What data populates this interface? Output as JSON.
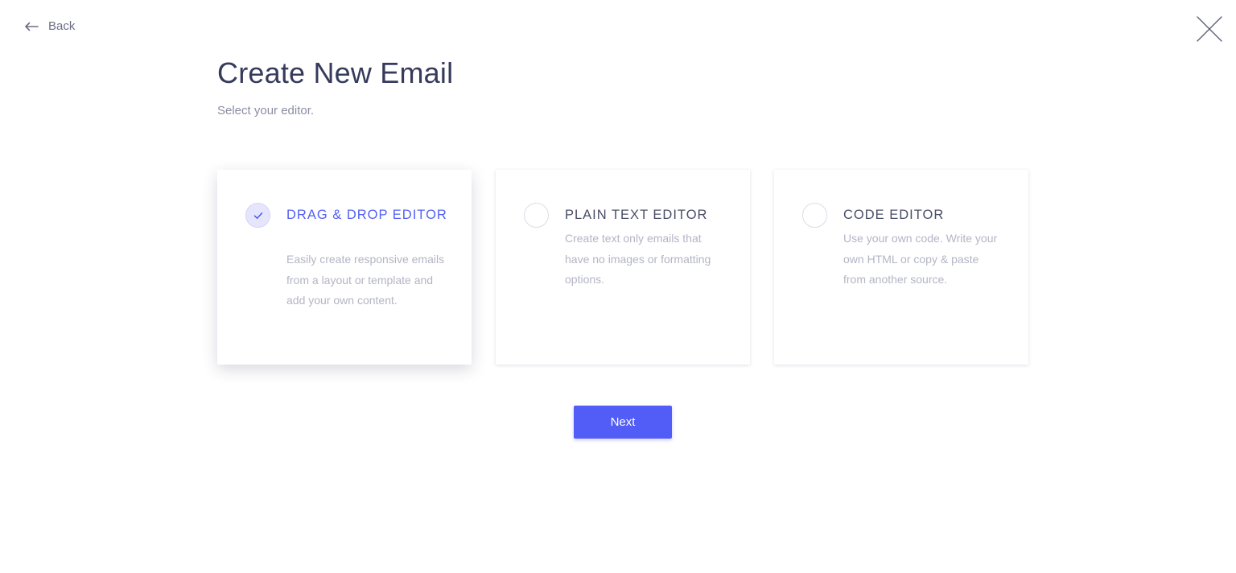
{
  "header": {
    "back_label": "Back",
    "back_icon": "arrow-left-icon",
    "close_icon": "close-icon"
  },
  "page": {
    "title": "Create New Email",
    "subtitle": "Select your editor."
  },
  "editors": [
    {
      "title": "DRAG & DROP EDITOR",
      "description": "Easily create responsive emails from a layout or template and add your own content.",
      "selected": true
    },
    {
      "title": "PLAIN TEXT EDITOR",
      "description": "Create text only emails that have no images or formatting options.",
      "selected": false
    },
    {
      "title": "CODE EDITOR",
      "description": "Use your own code. Write your own HTML or copy & paste from another source.",
      "selected": false
    }
  ],
  "actions": {
    "next_label": "Next"
  },
  "colors": {
    "accent": "#525df7",
    "selected_title": "#5261f5",
    "heading": "#363b5c",
    "muted_text": "#b3b5c4"
  }
}
